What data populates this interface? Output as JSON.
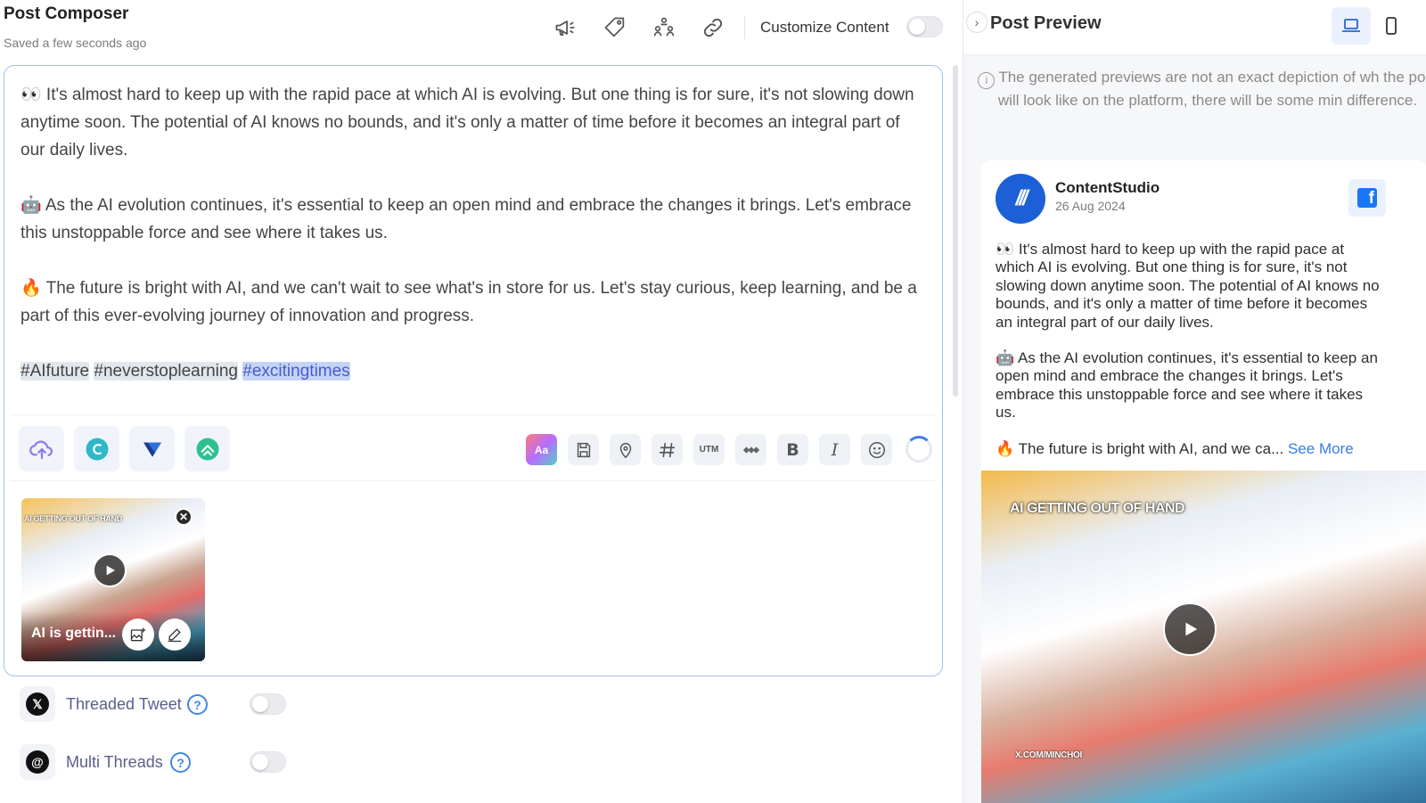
{
  "header": {
    "title": "Post Composer",
    "saved_status": "Saved a few seconds ago",
    "icons": [
      "megaphone-icon",
      "tag-icon",
      "users-icon",
      "link-icon"
    ],
    "customize_label": "Customize Content",
    "customize_on": false
  },
  "editor": {
    "paragraphs": [
      "👀 It's almost hard to keep up with the rapid pace at which AI is evolving. But one thing is for sure, it's not slowing down anytime soon. The potential of AI knows no bounds, and it's only a matter of time before it becomes an integral part of our daily lives.",
      "🤖 As the AI evolution continues, it's essential to keep an open mind and embrace the changes it brings. Let's embrace this unstoppable force and see where it takes us.",
      "🔥 The future is bright with AI, and we can't wait to see what's in store for us. Let's stay curious, keep learning, and be a part of this ever-evolving journey of innovation and progress."
    ],
    "hashtags": [
      "#AIfuture",
      "#neverstoplearning",
      "#excitingtimes"
    ],
    "integrations": [
      "upload-cloud-icon",
      "canva-icon",
      "vistacreate-icon",
      "postnitro-icon"
    ],
    "tool_labels": {
      "utm": "UTM"
    },
    "tools": [
      "ai-text-icon",
      "save-icon",
      "location-icon",
      "hashtag-icon",
      "utm-icon",
      "link-shortener-icon",
      "bold-icon",
      "italic-icon",
      "emoji-icon"
    ]
  },
  "media": {
    "caption": "AI GETTING OUT OF HAND",
    "title": "AI is gettin..."
  },
  "options": [
    {
      "label": "Threaded Tweet",
      "icon": "x-logo-icon",
      "enabled": false
    },
    {
      "label": "Multi Threads",
      "icon": "threads-logo-icon",
      "enabled": false
    }
  ],
  "preview": {
    "title": "Post Preview",
    "device": "desktop",
    "disclaimer": "The generated previews are not an exact depiction of wh the post will look like on the platform, there will be some min difference.",
    "account_name": "ContentStudio",
    "date": "26 Aug 2024",
    "platform": "facebook",
    "paragraphs": [
      "👀 It's almost hard to keep up with the rapid pace at which AI is evolving. But one thing is for sure, it's not slowing down anytime soon. The potential of AI knows no bounds, and it's only a matter of time before it becomes an integral part of our daily lives.",
      "🤖 As the AI evolution continues, it's essential to keep an open mind and embrace the changes it brings. Let's embrace this unstoppable force and see where it takes us."
    ],
    "truncated_line": "🔥 The future is bright with AI, and we ca...",
    "see_more": "See More",
    "media_caption": "AI GETTING OUT OF HAND",
    "watermark": "X.COM/MINCHOI"
  },
  "colors": {
    "accent": "#3a7be8",
    "editor_border": "#9fbff2",
    "facebook": "#1877f2"
  }
}
